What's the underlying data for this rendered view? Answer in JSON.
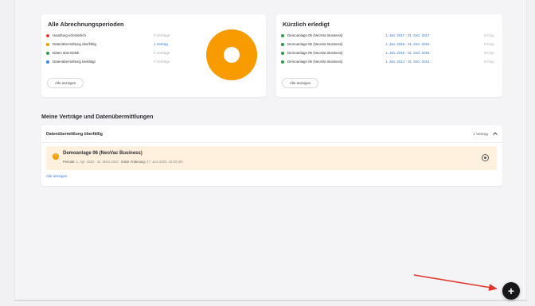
{
  "colors": {
    "accent_orange": "#f89b00",
    "link_blue": "#2f77d6",
    "status_red": "#e53935",
    "status_green": "#2e9a49",
    "status_blue": "#3f86d8",
    "overdue_bg": "#fff1de",
    "annotation_arrow": "#e0352b"
  },
  "periods_card": {
    "title": "Alle Abrechnungsperioden",
    "rows": [
      {
        "label": "Handlung erforderlich",
        "count": "0 Verträge",
        "dot": "red"
      },
      {
        "label": "Datenübermittlung überfällig",
        "count": "1 Vertrag",
        "dot": "orange"
      },
      {
        "label": "Daten übermittelt",
        "count": "0 Verträge",
        "dot": "green"
      },
      {
        "label": "Datenübermittlung bestätigt",
        "count": "0 Verträge",
        "dot": "blue"
      }
    ],
    "chart_data": {
      "type": "pie",
      "categories": [
        "Handlung erforderlich",
        "Datenübermittlung überfällig",
        "Daten übermittelt",
        "Datenübermittlung bestätigt"
      ],
      "values": [
        0,
        1,
        0,
        0
      ],
      "donut": true
    },
    "show_all": "Alle anzeigen"
  },
  "recent_card": {
    "title": "Kürzlich erledigt",
    "rows": [
      {
        "label": "Demoanlage 06 (NeoVac Business)",
        "period": "1. Jan. 2017 - 31. Dez. 2017",
        "status": "Erfolgt"
      },
      {
        "label": "Demoanlage 06 (NeoVac Business)",
        "period": "1. Jan. 2016 - 31. Dez. 2016",
        "status": "Erfolgt"
      },
      {
        "label": "Demoanlage 06 (NeoVac Business)",
        "period": "1. Jan. 2015 - 31. Dez. 2015",
        "status": "Erfolgt"
      },
      {
        "label": "Demoanlage 06 (NeoVac Business)",
        "period": "1. Jan. 2014 - 31. Dez. 2014",
        "status": "Erfolgt"
      }
    ],
    "show_all": "Alle anzeigen"
  },
  "contracts_section": {
    "title": "Meine Verträge und Datenübermittlungen",
    "group_title": "Datenübermittlung überfällig",
    "group_count": "1 Vertrag",
    "item": {
      "name": "Demoanlage 06 (NeoVac Business)",
      "period_label": "Periode:",
      "period_value": "1. Apr. 2022 - 31. März 2023",
      "separator": "·",
      "changed_label": "letzte Änderung:",
      "changed_value": "27. Juni 2023, 10:00 Uhr"
    },
    "show_all": "Alle anzeigen"
  },
  "fab": {
    "symbol": "+",
    "icon": "plus-icon"
  }
}
